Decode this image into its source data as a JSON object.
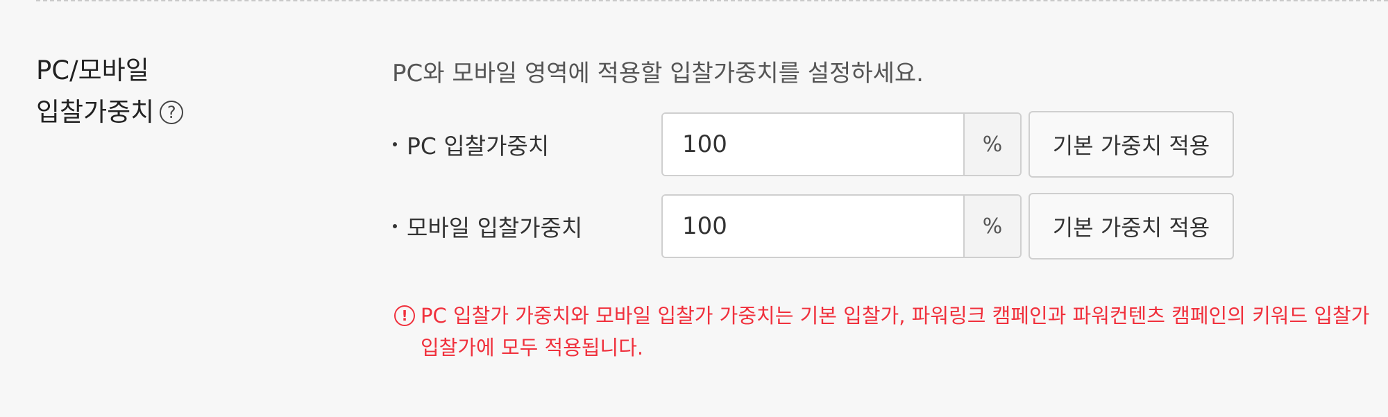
{
  "section": {
    "title_line1": "PC/모바일",
    "title_line2": "입찰가중치",
    "help_icon_symbol": "?"
  },
  "description": "PC와 모바일 영역에 적용할 입찰가중치를 설정하세요.",
  "rows": [
    {
      "label": "PC 입찰가중치",
      "value": "100",
      "unit": "%",
      "button_label": "기본 가중치 적용"
    },
    {
      "label": "모바일 입찰가중치",
      "value": "100",
      "unit": "%",
      "button_label": "기본 가중치 적용"
    }
  ],
  "notice": {
    "icon": "exclamation-circle-icon",
    "icon_symbol": "!",
    "line1": "PC 입찰가 가중치와 모바일 입찰가 가중치는 기본 입찰가, 파워링크 캠페인과 파워컨텐츠 캠페인의 키워드 입찰가",
    "line2": "입찰가에 모두 적용됩니다.",
    "color": "#f0303c"
  }
}
